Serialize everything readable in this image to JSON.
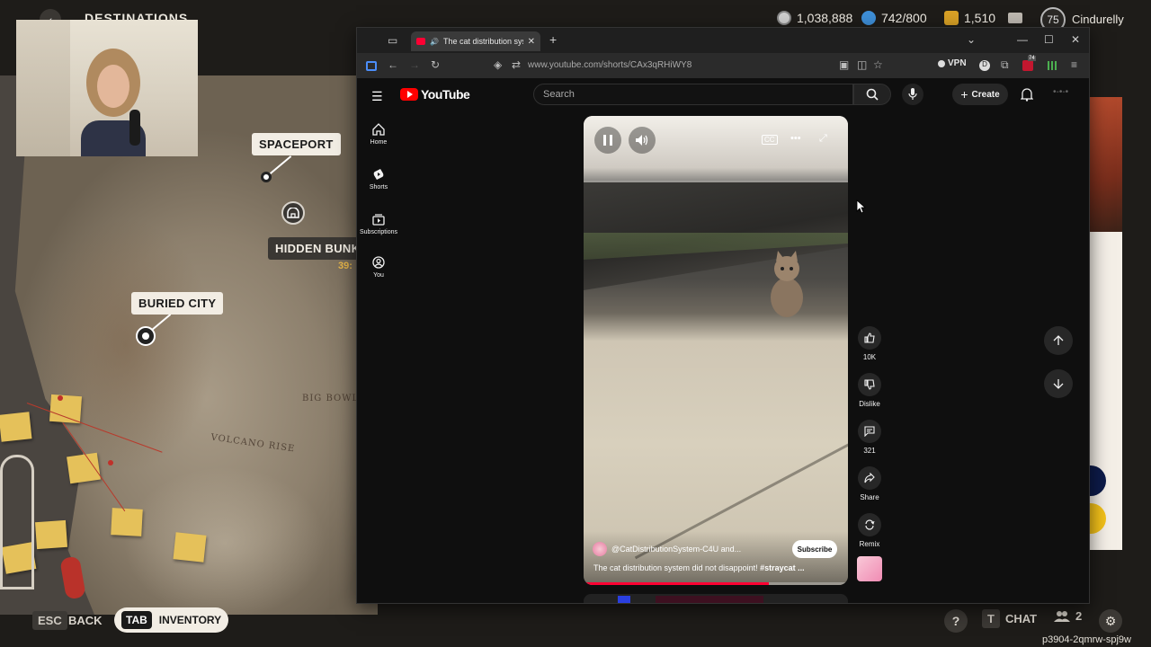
{
  "game": {
    "title": "DESTINATIONS",
    "stats": [
      {
        "icon": "coin-icon",
        "value": "1,038,888",
        "color": "#d0d0d0"
      },
      {
        "icon": "token-icon",
        "value": "742/800",
        "color": "#3e8fd8"
      },
      {
        "icon": "wheat-icon",
        "value": "1,510",
        "color": "#d9a126"
      }
    ],
    "level": "75",
    "username": "Cindurelly",
    "locations": {
      "spaceport": "SPACEPORT",
      "hidden_bunker": "HIDDEN BUNKE",
      "bunker_timer": "39:",
      "buried_city": "BURIED CITY"
    },
    "map_labels": {
      "big_bowl": "BIG BOWL",
      "volcano_rise": "VOLCANO RISE"
    },
    "bottom": {
      "esc_key": "ESC",
      "back_label": "BACK",
      "tab_key": "TAB",
      "inventory_label": "INVENTORY",
      "chat_key": "T",
      "chat_label": "CHAT",
      "party_count": "2",
      "session_id": "p3904-2qmrw-spj9w"
    }
  },
  "browser": {
    "tab_title": "The cat distribution system",
    "url": "www.youtube.com/shorts/CAx3qRHiWY8",
    "vpn_label": "VPN",
    "ext_badge": "74"
  },
  "youtube": {
    "logo_text": "YouTube",
    "search_placeholder": "Search",
    "create_label": "Create",
    "sidebar": [
      {
        "label": "Home",
        "icon": "home-icon"
      },
      {
        "label": "Shorts",
        "icon": "shorts-icon"
      },
      {
        "label": "Subscriptions",
        "icon": "subscriptions-icon"
      },
      {
        "label": "You",
        "icon": "user-icon"
      }
    ],
    "short": {
      "channel": "@CatDistributionSystem-C4U and...",
      "subscribe_label": "Subscribe",
      "caption": "The cat distribution system did not disappoint!",
      "hashtag": "#straycat ...",
      "progress": 0.7
    },
    "actions": {
      "likes": "10K",
      "dislike": "Dislike",
      "comments": "321",
      "share": "Share",
      "remix": "Remix"
    }
  }
}
